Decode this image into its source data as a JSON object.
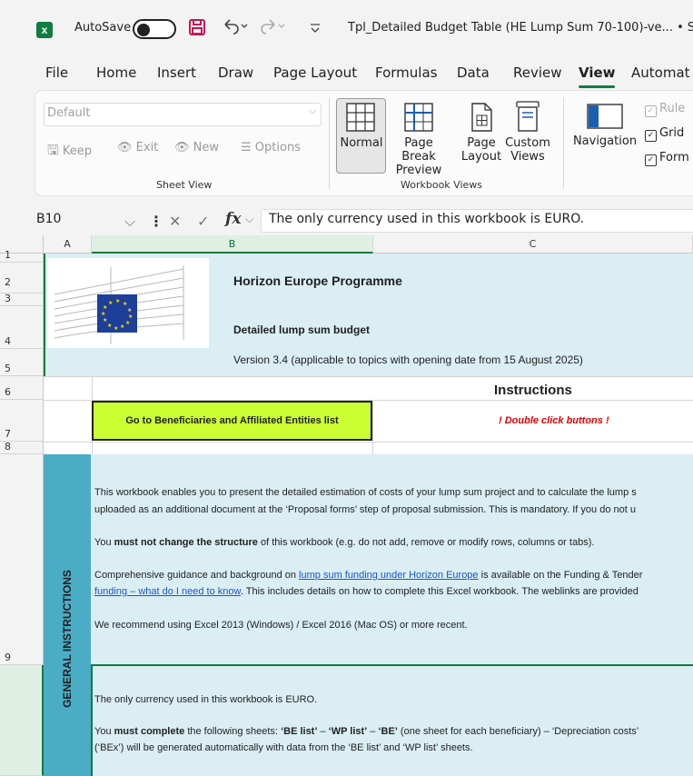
{
  "titlebar": {
    "app_icon": "excel-logo",
    "app_letter": "x",
    "autosave_label": "AutoSave",
    "autosave_state": "off",
    "doc_title": "Tpl_Detailed Budget Table (HE Lump Sum 70-100)-ve... • Sa"
  },
  "menu": {
    "tabs": [
      "File",
      "Home",
      "Insert",
      "Draw",
      "Page Layout",
      "Formulas",
      "Data",
      "Review",
      "View",
      "Automat"
    ],
    "active": "View"
  },
  "ribbon": {
    "sheet_view": {
      "dropdown_value": "Default",
      "buttons": [
        "Keep",
        "Exit",
        "New",
        "Options"
      ],
      "group_label": "Sheet View"
    },
    "workbook_views": {
      "normal": "Normal",
      "page_break_1": "Page Break",
      "page_break_2": "Preview",
      "page_layout_1": "Page",
      "page_layout_2": "Layout",
      "custom_1": "Custom",
      "custom_2": "Views",
      "group_label": "Workbook Views"
    },
    "navigation": "Navigation",
    "show": {
      "ruler": "Rule",
      "gridlines": "Grid",
      "formula_bar": "Form"
    }
  },
  "formula_bar": {
    "cell_ref": "B10",
    "fx": "fx",
    "content": "The only currency used in this workbook is EURO."
  },
  "columns": [
    "A",
    "B",
    "C"
  ],
  "rows": [
    "1",
    "2",
    "3",
    "4",
    "5",
    "6",
    "7",
    "8",
    "9"
  ],
  "sheet": {
    "title": "Horizon Europe Programme",
    "subtitle": "Detailed lump sum budget",
    "version": "Version 3.4 (applicable to topics with opening date from 15 August 2025)",
    "instructions_heading": "Instructions",
    "goto_button": "Go to Beneficiaries and Affiliated Entities list",
    "double_click_note": "! Double click buttons !",
    "side_label": "GENERAL INSTRUCTIONS",
    "para1_line1": "This workbook enables you to present the detailed estimation of costs of your lump sum project and to calculate the lump s",
    "para1_line2": "uploaded as an additional document at the ‘Proposal forms’ step of proposal submission. This is mandatory. If you do not u",
    "para2_pre": "You ",
    "para2_bold": "must not change the structure",
    "para2_post": " of this workbook (e.g. do not add, remove or modify rows, columns or tabs).",
    "para3_pre": "Comprehensive guidance and background on ",
    "para3_link": "lump sum funding under Horizon Europe",
    "para3_post": " is available on the Funding & Tender",
    "para3_line2_link": "funding – what do I need to know",
    "para3_line2_post": ". This includes details on how to complete this Excel workbook. The weblinks are provided",
    "para4": "We recommend using Excel 2013 (Windows) / Excel 2016 (Mac OS) or more recent.",
    "para5": "The only currency used in this workbook is EURO.",
    "para6_pre": "You ",
    "para6_bold1": "must complete",
    "para6_mid": " the following sheets: ",
    "para6_bold2": "‘BE list’",
    "para6_dash1": " – ",
    "para6_bold3": "‘WP list’",
    "para6_dash2": " – ",
    "para6_bold4": "‘BE’",
    "para6_post": " (one sheet for each beneficiary) – ‘Depreciation costs’",
    "para6_line2": "(‘BEx’) will be generated automatically with data from the ‘BE list’ and ‘WP list’ sheets."
  },
  "colors": {
    "band": "#daeef3",
    "side": "#4bacc6",
    "button": "#ccff33",
    "excel_green": "#107c41"
  }
}
